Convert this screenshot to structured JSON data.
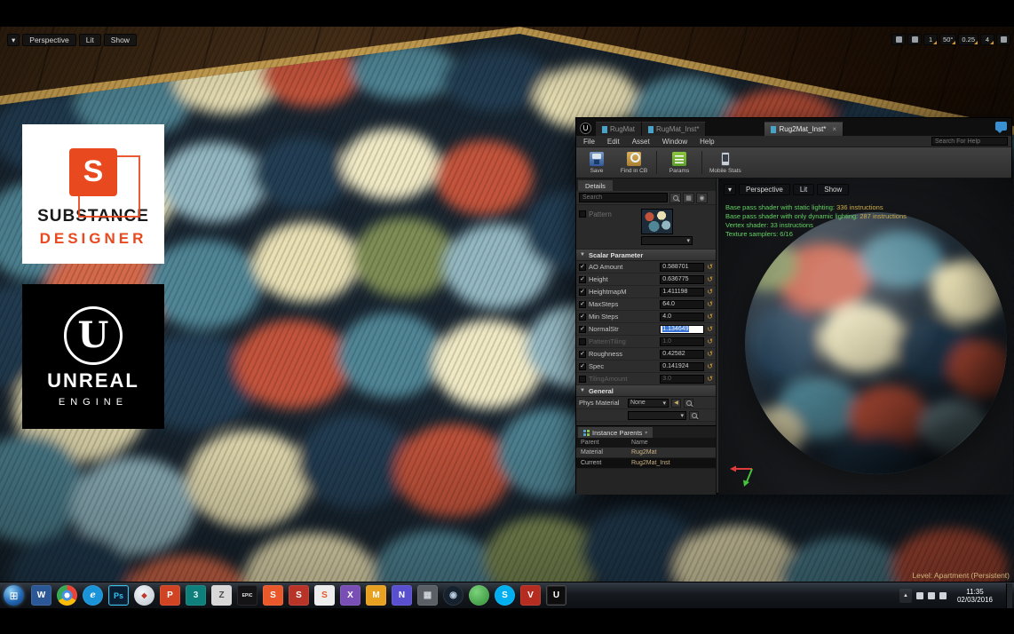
{
  "viewport": {
    "mode_dropdown_icon": "▾",
    "perspective": "Perspective",
    "lit": "Lit",
    "show": "Show",
    "snap": [
      {
        "name": "joystick-icon",
        "value": ""
      },
      {
        "name": "view-options-icon",
        "value": ""
      },
      {
        "name": "translate-snap-value",
        "value": "1"
      },
      {
        "name": "rotate-snap-value",
        "value": "50°"
      },
      {
        "name": "scale-snap-value",
        "value": "0.25"
      },
      {
        "name": "camera-speed-value",
        "value": "4"
      },
      {
        "name": "maximize-viewport-icon",
        "value": ""
      }
    ],
    "level_status": "Level: Apartment (Persistent)"
  },
  "logos": {
    "substance": {
      "glyph": "S",
      "line1": "SUBSTANCE",
      "line2": "DESIGNER"
    },
    "unreal": {
      "glyph": "U",
      "line1": "UNREAL",
      "line2": "ENGINE"
    }
  },
  "editor": {
    "window_icon": "U",
    "tabs": [
      {
        "label": "RugMat"
      },
      {
        "label": "RugMat_Inst*"
      },
      {
        "label": "Rug2Mat_Inst*",
        "close": "×"
      }
    ],
    "menus": [
      "File",
      "Edit",
      "Asset",
      "Window",
      "Help"
    ],
    "help_search_placeholder": "Search For Help",
    "toolbar": {
      "save": "Save",
      "find": "Find in CB",
      "params": "Params",
      "mobile": "Mobile Stats"
    },
    "details": {
      "title": "Details",
      "search_placeholder": "Search",
      "texture_param_label": "Pattern",
      "scalar_header": "Scalar Parameter",
      "params": [
        {
          "label": "AO Amount",
          "value": "0.588701"
        },
        {
          "label": "Height",
          "value": "0.636775"
        },
        {
          "label": "HeightmapM",
          "value": "1.411198"
        },
        {
          "label": "MaxSteps",
          "value": "64.0"
        },
        {
          "label": "Min Steps",
          "value": "4.0"
        },
        {
          "label": "NormalStr",
          "value": "1.134649"
        },
        {
          "label": "PatternTiling",
          "value": "1.0"
        },
        {
          "label": "Roughness",
          "value": "0.42582"
        },
        {
          "label": "Spec",
          "value": "0.141924"
        },
        {
          "label": "TilingAmount",
          "value": "3.0"
        }
      ],
      "general_header": "General",
      "phys_material_label": "Phys Material",
      "phys_material_value": "None"
    },
    "instance_parents": {
      "title": "Instance Parents",
      "columns": [
        "Parent",
        "Name"
      ],
      "rows": [
        {
          "parent": "Material",
          "name": "Rug2Mat"
        },
        {
          "parent": "Current",
          "name": "Rug2Mat_Inst"
        }
      ]
    },
    "preview": {
      "mode_dropdown_icon": "▾",
      "perspective": "Perspective",
      "lit": "Lit",
      "show": "Show",
      "stats": [
        {
          "prefix": "Base pass shader with static lighting:",
          "value": "336 instructions"
        },
        {
          "prefix": "Base pass shader with only dynamic lighting:",
          "value": "287 instructions"
        },
        {
          "prefix": "Vertex shader:",
          "value": "33 instructions"
        },
        {
          "prefix": "Texture samplers:",
          "value": "6/16"
        }
      ]
    }
  },
  "taskbar": {
    "start_glyph": "⊞",
    "icons": [
      {
        "name": "word-icon",
        "glyph": "W",
        "bg": "#2b5797",
        "fg": "#ffffff"
      },
      {
        "name": "chrome-icon",
        "glyph": "",
        "bg": "radial-gradient(circle at 50% 50%, #ffffff 0 3px, #4a90e2 3px 6px, transparent 6px), conic-gradient(#ea4335 0 33%, #fbbc05 33% 66%, #34a853 66% 100%)",
        "fg": "#ffffff",
        "cls": "round"
      },
      {
        "name": "internet-explorer-icon",
        "glyph": "e",
        "bg": "#1b93d8",
        "fg": "#ffffff",
        "cls": "round italic"
      },
      {
        "name": "photoshop-icon",
        "glyph": "Ps",
        "bg": "#0a1f33",
        "fg": "#35c3f2",
        "fs": 9,
        "border": "1px solid #35c3f2"
      },
      {
        "name": "compass-icon",
        "glyph": "◆",
        "bg": "radial-gradient(circle at 40% 35%, #f2f6f9, #b9c2cb)",
        "fg": "#c0392b",
        "cls": "round",
        "fs": 8
      },
      {
        "name": "powerpoint-icon",
        "glyph": "P",
        "bg": "#d04423",
        "fg": "#ffffff"
      },
      {
        "name": "3dsmax-icon",
        "glyph": "3",
        "bg": "#0f7f7b",
        "fg": "#dff3f2"
      },
      {
        "name": "zbrush-icon",
        "glyph": "Z",
        "bg": "#d8d8d8",
        "fg": "#4a4a4a"
      },
      {
        "name": "epic-games-icon",
        "glyph": "EPIC",
        "bg": "#141416",
        "fg": "#e8e8e8",
        "fs": 5
      },
      {
        "name": "substance-painter-icon",
        "glyph": "S",
        "bg": "#e8582a",
        "fg": "#ffffff"
      },
      {
        "name": "substance-b2m-icon",
        "glyph": "S",
        "bg": "#b83428",
        "fg": "#ffffff"
      },
      {
        "name": "substance-designer-icon",
        "glyph": "S",
        "bg": "#ededed",
        "fg": "#e8582a"
      },
      {
        "name": "xnormal-icon",
        "glyph": "X",
        "bg": "#7a4fb5",
        "fg": "#ffffff"
      },
      {
        "name": "mail-icon",
        "glyph": "M",
        "bg": "#e8a020",
        "fg": "#ffffff"
      },
      {
        "name": "ndo-icon",
        "glyph": "N",
        "bg": "#5a4fcf",
        "fg": "#ffffff"
      },
      {
        "name": "cube-app-icon",
        "glyph": "▦",
        "bg": "#5a5f66",
        "fg": "#cfd4da"
      },
      {
        "name": "steam-icon",
        "glyph": "◉",
        "bg": "#16212e",
        "fg": "#b8cce0",
        "cls": "round"
      },
      {
        "name": "green-app-icon",
        "glyph": "",
        "bg": "radial-gradient(circle at 38% 32%, #7cd37c, #2e8b33)",
        "fg": "#ffffff",
        "cls": "round"
      },
      {
        "name": "skype-icon",
        "glyph": "S",
        "bg": "#00aff0",
        "fg": "#ffffff",
        "cls": "round"
      },
      {
        "name": "vray-icon",
        "glyph": "V",
        "bg": "#b52c20",
        "fg": "#ffffff"
      },
      {
        "name": "unreal-launcher-icon",
        "glyph": "U",
        "bg": "#0d0d0d",
        "fg": "#ffffff",
        "border": "1px solid #4a4a4a"
      }
    ],
    "tray": {
      "hidden_icons_glyph": "▲",
      "time": "11:35",
      "date": "02/03/2016"
    }
  },
  "colors": {
    "accent_orange": "#e8a33d",
    "stat_green": "#63d163",
    "substance_orange": "#e8491f",
    "level_text_tan": "#cdb27c"
  }
}
